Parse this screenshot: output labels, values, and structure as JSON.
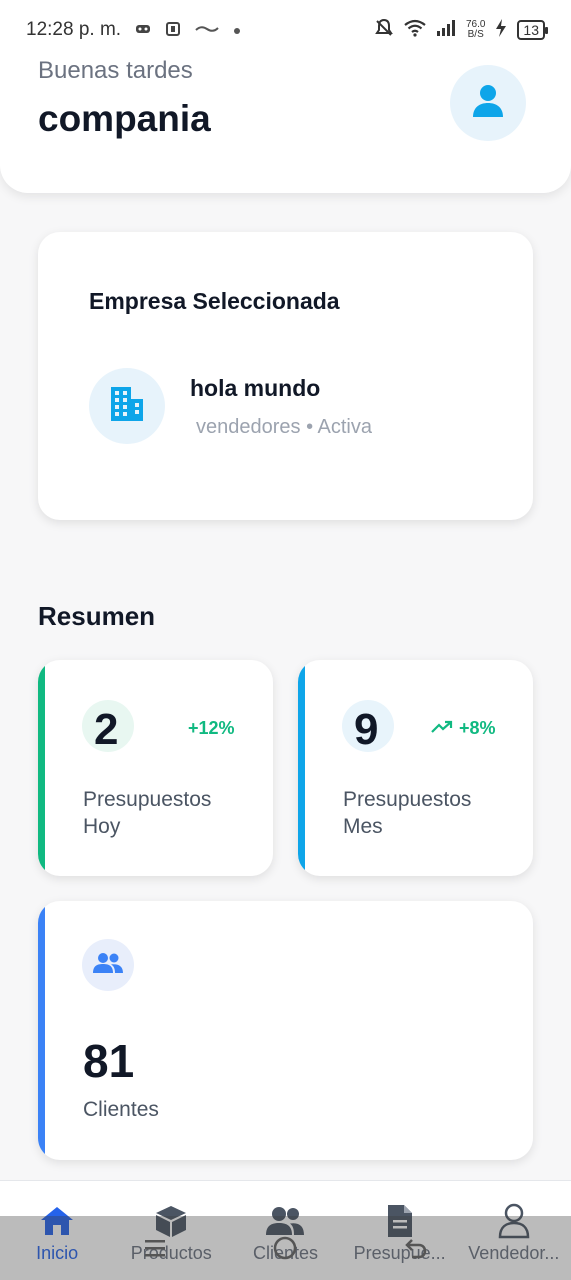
{
  "status_bar": {
    "time": "12:28 p. m.",
    "net_speed_value": "76.0",
    "net_speed_unit": "B/S",
    "battery": "13"
  },
  "header": {
    "greeting": "Buenas tardes",
    "company": "compania"
  },
  "empresa": {
    "title": "Empresa Seleccionada",
    "name": "hola mundo",
    "meta": "vendedores • Activa"
  },
  "resumen": {
    "title": "Resumen",
    "hoy": {
      "value": "2",
      "change": "+12%",
      "label": "Presupuestos Hoy",
      "accent": "#10b981"
    },
    "mes": {
      "value": "9",
      "change": "+8%",
      "label": "Presupuestos Mes",
      "accent": "#0ea5e9"
    },
    "clientes": {
      "value": "81",
      "label": "Clientes",
      "accent": "#3b82f6"
    }
  },
  "nav": {
    "items": [
      {
        "label": "Inicio",
        "icon": "home-icon"
      },
      {
        "label": "Productos",
        "icon": "box-icon"
      },
      {
        "label": "Clientes",
        "icon": "users-icon"
      },
      {
        "label": "Presupue...",
        "icon": "document-icon"
      },
      {
        "label": "Vendedor...",
        "icon": "person-icon"
      }
    ]
  },
  "colors": {
    "primary": "#2563eb",
    "sky": "#0ea5e9",
    "green": "#10b981"
  }
}
